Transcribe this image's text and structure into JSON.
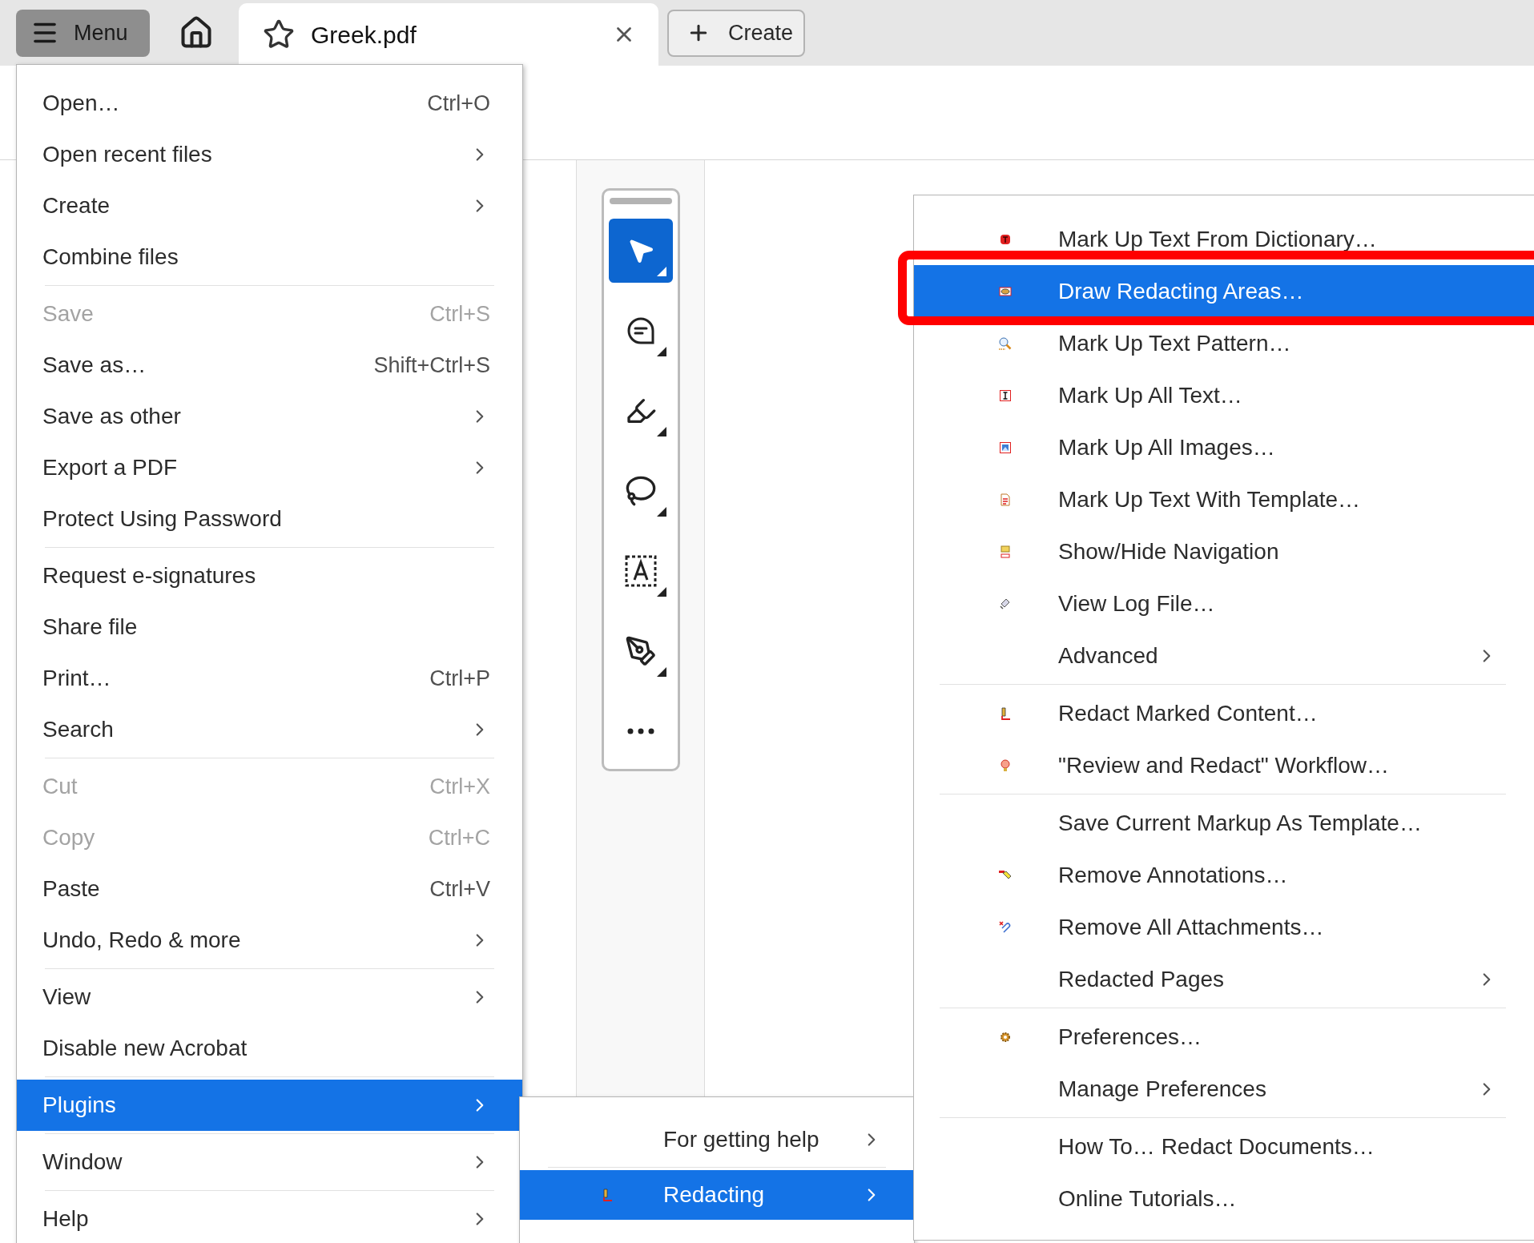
{
  "top_bar": {
    "menu_button": {
      "label": "Menu",
      "pressed": true
    },
    "tab": {
      "label": "Greek.pdf",
      "selected": true
    },
    "create_button": {
      "label": "Create"
    }
  },
  "toolbar": {
    "tools": [
      {
        "selected": true
      },
      {
        "selected": false
      },
      {
        "selected": false
      },
      {
        "selected": false
      },
      {
        "selected": false
      },
      {
        "selected": false
      },
      {
        "selected": false
      }
    ]
  },
  "main_menu": {
    "groups": [
      [
        {
          "label": "Open…",
          "shortcut": "Ctrl+O",
          "submenu": false,
          "disabled": false,
          "selected": false
        },
        {
          "label": "Open recent files",
          "submenu": true,
          "disabled": false,
          "selected": false
        },
        {
          "label": "Create",
          "submenu": true,
          "disabled": false,
          "selected": false
        },
        {
          "label": "Combine files",
          "submenu": false,
          "disabled": false,
          "selected": false
        }
      ],
      [
        {
          "label": "Save",
          "shortcut": "Ctrl+S",
          "submenu": false,
          "disabled": true,
          "selected": false
        },
        {
          "label": "Save as…",
          "shortcut": "Shift+Ctrl+S",
          "submenu": false,
          "disabled": false,
          "selected": false
        },
        {
          "label": "Save as other",
          "submenu": true,
          "disabled": false,
          "selected": false
        },
        {
          "label": "Export a PDF",
          "submenu": true,
          "disabled": false,
          "selected": false
        },
        {
          "label": "Protect Using Password",
          "submenu": false,
          "disabled": false,
          "selected": false
        }
      ],
      [
        {
          "label": "Request e-signatures",
          "submenu": false,
          "disabled": false,
          "selected": false
        },
        {
          "label": "Share file",
          "submenu": false,
          "disabled": false,
          "selected": false
        },
        {
          "label": "Print…",
          "shortcut": "Ctrl+P",
          "submenu": false,
          "disabled": false,
          "selected": false
        },
        {
          "label": "Search",
          "submenu": true,
          "disabled": false,
          "selected": false
        }
      ],
      [
        {
          "label": "Cut",
          "shortcut": "Ctrl+X",
          "submenu": false,
          "disabled": true,
          "selected": false
        },
        {
          "label": "Copy",
          "shortcut": "Ctrl+C",
          "submenu": false,
          "disabled": true,
          "selected": false
        },
        {
          "label": "Paste",
          "shortcut": "Ctrl+V",
          "submenu": false,
          "disabled": false,
          "selected": false
        },
        {
          "label": "Undo, Redo & more",
          "submenu": true,
          "disabled": false,
          "selected": false
        }
      ],
      [
        {
          "label": "View",
          "submenu": true,
          "disabled": false,
          "selected": false
        },
        {
          "label": "Disable new Acrobat",
          "submenu": false,
          "disabled": false,
          "selected": false
        }
      ],
      [
        {
          "label": "Plugins",
          "submenu": true,
          "disabled": false,
          "selected": true
        }
      ],
      [
        {
          "label": "Window",
          "submenu": true,
          "disabled": false,
          "selected": false
        }
      ],
      [
        {
          "label": "Help",
          "submenu": true,
          "disabled": false,
          "selected": false
        }
      ]
    ]
  },
  "plugins_menu": {
    "groups": [
      [
        {
          "label": "For getting help",
          "submenu": true,
          "selected": false
        }
      ],
      [
        {
          "label": "Redacting",
          "submenu": true,
          "selected": true
        }
      ]
    ]
  },
  "redacting_menu": {
    "groups": [
      [
        {
          "label": "Mark Up Text From Dictionary…",
          "submenu": false,
          "selected": false,
          "framed": false
        },
        {
          "label": "Draw Redacting Areas…",
          "submenu": false,
          "selected": true,
          "framed": true
        },
        {
          "label": "Mark Up Text Pattern…",
          "submenu": false,
          "selected": false,
          "framed": false
        },
        {
          "label": "Mark Up All Text…",
          "submenu": false,
          "selected": false,
          "framed": false
        },
        {
          "label": "Mark Up All Images…",
          "submenu": false,
          "selected": false,
          "framed": false
        },
        {
          "label": "Mark Up Text With Template…",
          "submenu": false,
          "selected": false,
          "framed": false
        },
        {
          "label": "Show/Hide Navigation",
          "submenu": false,
          "selected": false,
          "framed": false
        },
        {
          "label": "View Log File…",
          "submenu": false,
          "selected": false,
          "framed": false
        },
        {
          "label": "Advanced",
          "submenu": true,
          "selected": false,
          "framed": false
        }
      ],
      [
        {
          "label": "Redact Marked Content…",
          "submenu": false,
          "selected": false,
          "framed": false
        },
        {
          "label": "\"Review and Redact\" Workflow…",
          "submenu": false,
          "selected": false,
          "framed": false
        }
      ],
      [
        {
          "label": "Save Current Markup As Template…",
          "submenu": false,
          "selected": false,
          "framed": false
        },
        {
          "label": "Remove Annotations…",
          "submenu": false,
          "selected": false,
          "framed": false
        },
        {
          "label": "Remove All Attachments…",
          "submenu": false,
          "selected": false,
          "framed": false
        },
        {
          "label": "Redacted Pages",
          "submenu": true,
          "selected": false,
          "framed": false
        }
      ],
      [
        {
          "label": "Preferences…",
          "submenu": false,
          "selected": false,
          "framed": false
        },
        {
          "label": "Manage Preferences",
          "submenu": true,
          "selected": false,
          "framed": false
        }
      ],
      [
        {
          "label": "How To… Redact Documents…",
          "submenu": false,
          "selected": false,
          "framed": false
        },
        {
          "label": "Online Tutorials…",
          "submenu": false,
          "selected": false,
          "framed": false
        }
      ]
    ]
  }
}
